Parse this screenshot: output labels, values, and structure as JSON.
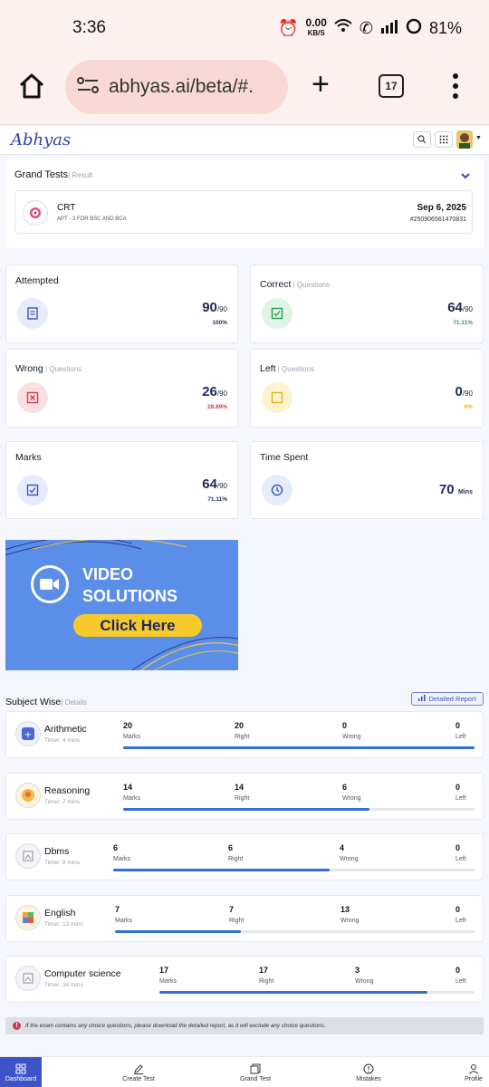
{
  "status": {
    "time": "3:36",
    "speed_value": "0.00",
    "speed_unit": "KB/S",
    "battery": "81%"
  },
  "browser": {
    "url": "abhyas.ai/beta/#.",
    "tabs": "17"
  },
  "app": {
    "logo": "Abhyas"
  },
  "grand": {
    "title": "Grand Tests",
    "sub": "| Result",
    "test_name": "CRT",
    "test_desc": "APT - 3 FOR BSC AND BCA",
    "date": "Sep 6, 2025",
    "id": "#250906561470831"
  },
  "cards": {
    "attempted": {
      "label": "Attempted",
      "value": "90",
      "total": "/90",
      "pct": "100%"
    },
    "correct": {
      "label": "Correct",
      "sub": " | Questions",
      "value": "64",
      "total": "/90",
      "pct": "71.11%"
    },
    "wrong": {
      "label": "Wrong",
      "sub": " | Questions",
      "value": "26",
      "total": "/90",
      "pct": "28.89%"
    },
    "left": {
      "label": "Left",
      "sub": " | Questions",
      "value": "0",
      "total": "/90",
      "pct": "0%"
    },
    "marks": {
      "label": "Marks",
      "value": "64",
      "total": "/90",
      "pct": "71.11%"
    },
    "time": {
      "label": "Time Spent",
      "value": "70",
      "unit": "Mins"
    }
  },
  "banner": {
    "line1": "VIDEO",
    "line2": "SOLUTIONS",
    "cta": "Click Here"
  },
  "subject": {
    "title": "Subject Wise",
    "sub": "| Details",
    "report": "Detailed Report",
    "col_marks": "Marks",
    "col_right": "Right",
    "col_wrong": "Wrong",
    "col_left": "Left"
  },
  "subjects": [
    {
      "name": "Arithmetic",
      "timer": "Timer: 4 mins",
      "marks": "20",
      "right": "20",
      "wrong": "0",
      "left": "0",
      "progress": 1.0
    },
    {
      "name": "Reasoning",
      "timer": "Timer: 7 mins",
      "marks": "14",
      "right": "14",
      "wrong": "6",
      "left": "0",
      "progress": 0.7
    },
    {
      "name": "Dbms",
      "timer": "Timer: 8 mins",
      "marks": "6",
      "right": "6",
      "wrong": "4",
      "left": "0",
      "progress": 0.6
    },
    {
      "name": "English",
      "timer": "Timer: 13 mins",
      "marks": "7",
      "right": "7",
      "wrong": "13",
      "left": "0",
      "progress": 0.35
    },
    {
      "name": "Computer science",
      "timer": "Timer: 34 mins",
      "marks": "17",
      "right": "17",
      "wrong": "3",
      "left": "0",
      "progress": 0.85
    }
  ],
  "note": "If the exam contains any choice questions, please download the detailed report, as it will exclude any choice questions.",
  "nav": {
    "dashboard": "Dashboard",
    "create": "Create Test",
    "grand": "Grand Test",
    "mistakes": "Mistakes",
    "profile": "Profile"
  }
}
